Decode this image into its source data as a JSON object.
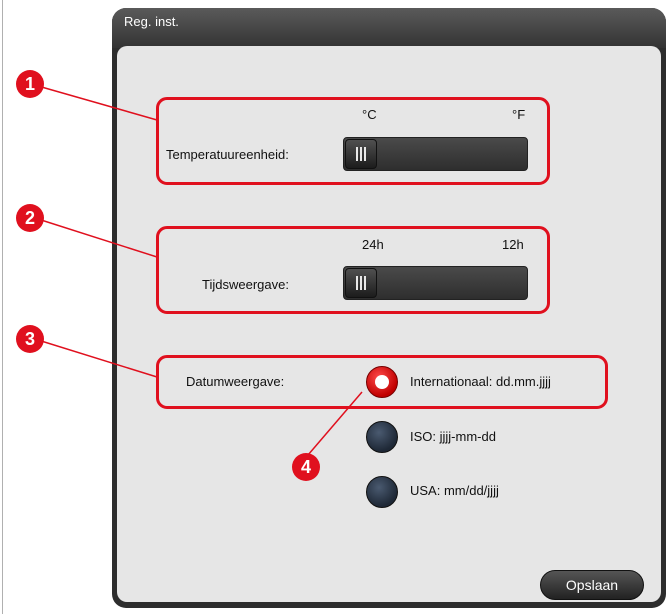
{
  "window": {
    "title": "Reg. inst."
  },
  "temperature": {
    "label": "Temperatuureenheid:",
    "left_option": "°C",
    "right_option": "°F",
    "selected": "°C"
  },
  "time": {
    "label": "Tijdsweergave:",
    "left_option": "24h",
    "right_option": "12h",
    "selected": "24h"
  },
  "date": {
    "label": "Datumweergave:",
    "options": [
      {
        "label": "Internationaal: dd.mm.jjjj",
        "selected": true
      },
      {
        "label": "ISO: jjjj-mm-dd",
        "selected": false
      },
      {
        "label": "USA: mm/dd/jjjj",
        "selected": false
      }
    ]
  },
  "buttons": {
    "save": "Opslaan"
  },
  "callouts": [
    "1",
    "2",
    "3",
    "4"
  ],
  "colors": {
    "highlight": "#e0101e",
    "window_frame": "#2d2d2d",
    "panel": "#e6e6e6"
  }
}
